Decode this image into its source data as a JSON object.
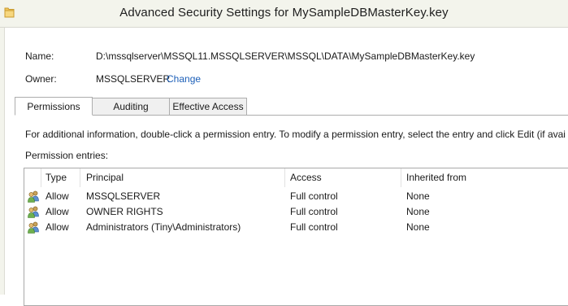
{
  "window": {
    "title": "Advanced Security Settings for MySampleDBMasterKey.key",
    "icon": "folder-icon"
  },
  "name_row": {
    "label": "Name:",
    "value": "D:\\mssqlserver\\MSSQL11.MSSQLSERVER\\MSSQL\\DATA\\MySampleDBMasterKey.key"
  },
  "owner_row": {
    "label": "Owner:",
    "value": "MSSQLSERVER",
    "change_link": "Change"
  },
  "tabs": [
    {
      "label": "Permissions",
      "active": true
    },
    {
      "label": "Auditing",
      "active": false
    },
    {
      "label": "Effective Access",
      "active": false
    }
  ],
  "info_text": "For additional information, double-click a permission entry. To modify a permission entry, select the entry and click Edit (if avai",
  "entries_label": "Permission entries:",
  "grid": {
    "columns": [
      "Type",
      "Principal",
      "Access",
      "Inherited from"
    ],
    "rows": [
      {
        "type": "Allow",
        "principal": "MSSQLSERVER",
        "access": "Full control",
        "inherited": "None",
        "icon": "users-icon"
      },
      {
        "type": "Allow",
        "principal": "OWNER RIGHTS",
        "access": "Full control",
        "inherited": "None",
        "icon": "users-icon"
      },
      {
        "type": "Allow",
        "principal": "Administrators (Tiny\\Administrators)",
        "access": "Full control",
        "inherited": "None",
        "icon": "users-icon"
      }
    ]
  },
  "colors": {
    "link": "#1c5fb8",
    "titlebar": "#f3f4ec",
    "border": "#adadad"
  }
}
